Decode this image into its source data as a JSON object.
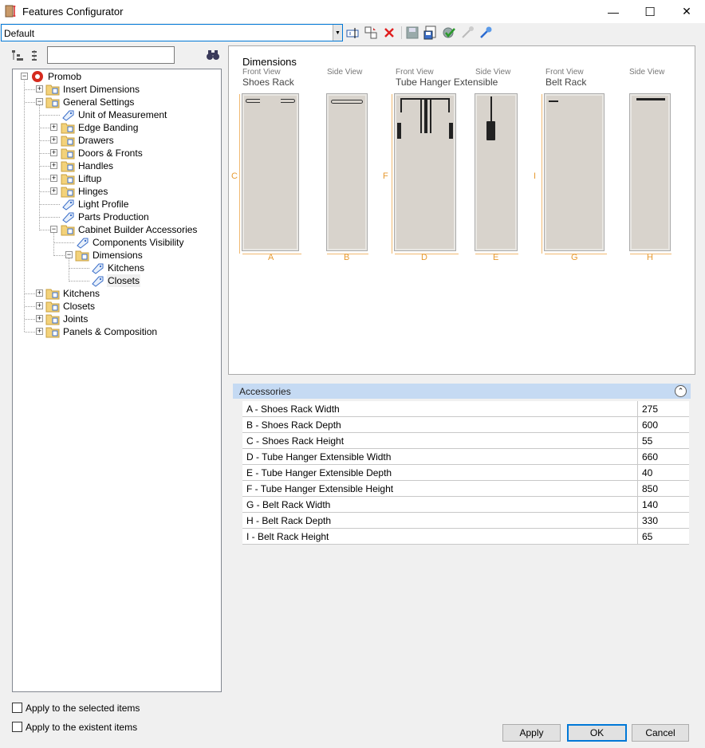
{
  "window": {
    "title": "Features Configurator",
    "minimize": "—",
    "maximize": "☐",
    "close": "✕"
  },
  "toolbar": {
    "profile_value": "Default"
  },
  "tree": {
    "nodes": [
      {
        "label": "Promob"
      },
      {
        "label": "Insert Dimensions"
      },
      {
        "label": "General Settings"
      },
      {
        "label": "Unit of Measurement"
      },
      {
        "label": "Edge Banding"
      },
      {
        "label": "Drawers"
      },
      {
        "label": "Doors & Fronts"
      },
      {
        "label": "Handles"
      },
      {
        "label": "Liftup"
      },
      {
        "label": "Hinges"
      },
      {
        "label": "Light Profile"
      },
      {
        "label": "Parts Production"
      },
      {
        "label": "Cabinet Builder Accessories"
      },
      {
        "label": "Components Visibility"
      },
      {
        "label": "Dimensions"
      },
      {
        "label": "Kitchens"
      },
      {
        "label": "Closets"
      },
      {
        "label": "Kitchens"
      },
      {
        "label": "Closets"
      },
      {
        "label": "Joints"
      },
      {
        "label": "Panels & Composition"
      }
    ]
  },
  "options": {
    "apply_selected": "Apply to the selected items",
    "apply_existent": "Apply to the existent items"
  },
  "preview": {
    "title": "Dimensions",
    "groups": [
      {
        "front_label": "Front View",
        "side_label": "Side View",
        "name": "Shoes Rack",
        "width_letter": "A",
        "depth_letter": "B",
        "height_letter": "C"
      },
      {
        "front_label": "Front View",
        "side_label": "Side View",
        "name": "Tube Hanger Extensible",
        "width_letter": "D",
        "depth_letter": "E",
        "height_letter": "F"
      },
      {
        "front_label": "Front View",
        "side_label": "Side View",
        "name": "Belt Rack",
        "width_letter": "G",
        "depth_letter": "H",
        "height_letter": "I"
      }
    ]
  },
  "accessories": {
    "title": "Accessories",
    "rows": [
      {
        "name": "A -  Shoes Rack Width",
        "value": "275"
      },
      {
        "name": "B -  Shoes Rack Depth",
        "value": "600"
      },
      {
        "name": "C -  Shoes Rack Height",
        "value": "55"
      },
      {
        "name": "D -  Tube Hanger Extensible Width",
        "value": "660"
      },
      {
        "name": "E -  Tube Hanger Extensible Depth",
        "value": "40"
      },
      {
        "name": "F -  Tube Hanger Extensible Height",
        "value": "850"
      },
      {
        "name": "G -  Belt Rack Width",
        "value": "140"
      },
      {
        "name": "H -  Belt Rack Depth",
        "value": "330"
      },
      {
        "name": "I -  Belt Rack Height",
        "value": "65"
      }
    ]
  },
  "buttons": {
    "apply": "Apply",
    "ok": "OK",
    "cancel": "Cancel"
  },
  "colors": {
    "accent": "#0078d7",
    "dimension": "#e79a31",
    "section_header": "#c5daf3",
    "cabinet": "#d8d3cc"
  }
}
